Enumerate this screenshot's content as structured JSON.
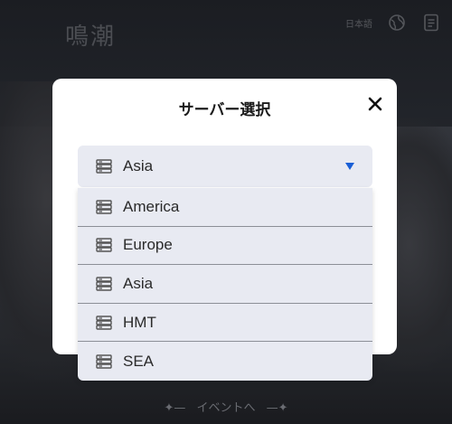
{
  "logo": {
    "text": "鳴潮"
  },
  "top_bar": {
    "language_label": "日本語",
    "icons": [
      "globe-icon",
      "document-icon"
    ]
  },
  "modal": {
    "title": "サーバー選択",
    "close_icon": "close-icon",
    "selected": "Asia",
    "options": [
      "America",
      "Europe",
      "Asia",
      "HMT",
      "SEA"
    ]
  },
  "footer": {
    "event_link": "イベントへ"
  },
  "colors": {
    "caret": "#1a5fd6",
    "select_bg": "#e8eaf2",
    "modal_bg": "#ffffff",
    "overlay": "#1b1d22"
  }
}
